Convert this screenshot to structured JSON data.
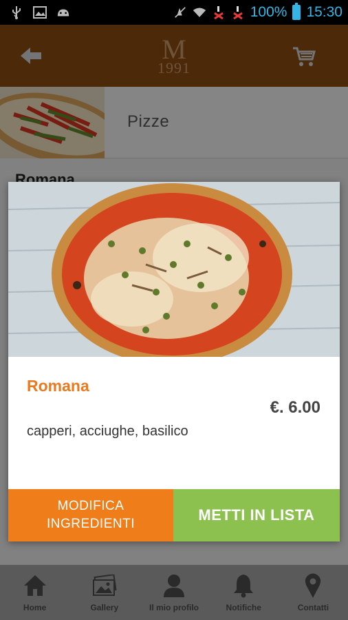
{
  "status_bar": {
    "battery": "100%",
    "time": "15:30",
    "icons": [
      "usb-icon",
      "image-icon",
      "android-icon",
      "mute-icon",
      "wifi-icon",
      "signal-off-icon",
      "signal-off-icon"
    ]
  },
  "header": {
    "logo_letter": "M",
    "logo_year": "1991",
    "back_icon": "arrow-left-icon",
    "cart_icon": "cart-icon"
  },
  "category": {
    "label": "Pizze"
  },
  "list": {
    "title": "Romana"
  },
  "modal": {
    "item_name": "Romana",
    "price": "€. 6.00",
    "description": "capperi, acciughe, basilico",
    "modify_button": "MODIFICA\nINGREDIENTI",
    "add_button": "METTI IN LISTA"
  },
  "bottom_nav": [
    {
      "label": "Home",
      "icon": "home-icon"
    },
    {
      "label": "Gallery",
      "icon": "gallery-icon"
    },
    {
      "label": "Il mio profilo",
      "icon": "user-icon"
    },
    {
      "label": "Notifiche",
      "icon": "bell-icon"
    },
    {
      "label": "Contatti",
      "icon": "map-pin-icon"
    }
  ],
  "colors": {
    "header": "#8a4b0f",
    "accent_orange": "#ee7d1a",
    "accent_green": "#8cc04f",
    "status_text": "#33b5e5"
  }
}
